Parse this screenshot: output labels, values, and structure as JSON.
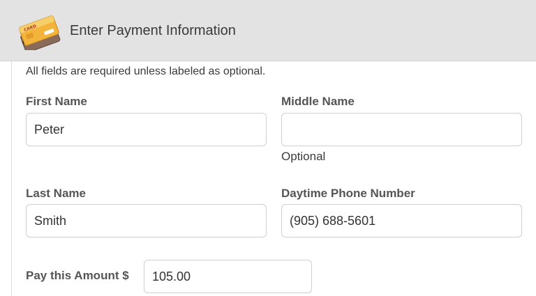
{
  "header": {
    "title": "Enter Payment Information",
    "icon": "credit-card-icon",
    "card_print": "CARD"
  },
  "form": {
    "note": "All fields are required unless labeled as optional.",
    "first_name": {
      "label": "First Name",
      "value": "Peter"
    },
    "middle_name": {
      "label": "Middle Name",
      "value": "",
      "help": "Optional"
    },
    "last_name": {
      "label": "Last Name",
      "value": "Smith"
    },
    "phone": {
      "label": "Daytime Phone Number",
      "value": "(905) 688-5601"
    },
    "amount": {
      "label": "Pay this Amount $",
      "value": "105.00"
    }
  },
  "colors": {
    "header_bg": "#e3e3e3",
    "card_gold": "#f2b43a",
    "input_border": "#cfcfcf"
  }
}
